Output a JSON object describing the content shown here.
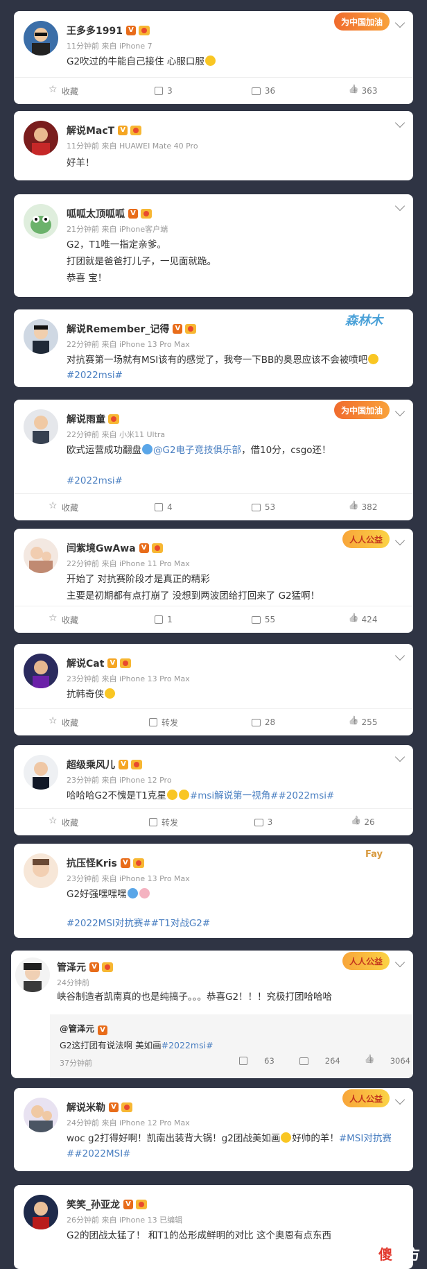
{
  "posts": [
    {
      "username": "王多多1991",
      "meta": "11分钟前 来自 iPhone 7",
      "lines": [
        "G2吹过的牛能自己接住 心服口服"
      ],
      "deco": "为中国加油",
      "actions": {
        "fav": "收藏",
        "share": "3",
        "comment": "36",
        "like": "363"
      }
    },
    {
      "username": "解说MacT",
      "meta": "11分钟前 来自 HUAWEI Mate 40 Pro",
      "lines": [
        "好羊！"
      ]
    },
    {
      "username": "呱呱太顶呱呱",
      "meta": "21分钟前 来自 iPhone客户端",
      "lines": [
        "G2，T1唯一指定亲爹。",
        "打团就是爸爸打儿子，一见面就跪。",
        "恭喜 宝！"
      ]
    },
    {
      "username": "解说Remember_记得",
      "meta": "22分钟前 来自 iPhone 13 Pro Max",
      "lines": [
        "对抗赛第一场就有MSI该有的感觉了，我夸一下BB的奥恩应该不会被喷吧"
      ],
      "tags": "#2022msi#",
      "deco": "森林木"
    },
    {
      "username": "解说雨童",
      "meta": "22分钟前 来自 小米11 Ultra",
      "line1a": "欧式运营成功翻盘",
      "mention": "@G2电子竞技俱乐部",
      "line1b": "，借10分，csgo还！",
      "tags": "#2022msi#",
      "deco": "为中国加油",
      "actions": {
        "fav": "收藏",
        "share": "4",
        "comment": "53",
        "like": "382"
      }
    },
    {
      "username": "闫紫境GwAwa",
      "meta": "22分钟前 来自 iPhone 11 Pro Max",
      "lines": [
        "开始了 对抗赛阶段才是真正的精彩",
        "主要是初期都有点打崩了 没想到两波团给打回来了 G2猛啊！"
      ],
      "deco": "人人公益",
      "actions": {
        "fav": "收藏",
        "share": "1",
        "comment": "55",
        "like": "424"
      }
    },
    {
      "username": "解说Cat",
      "meta": "23分钟前 来自 iPhone 13 Pro Max",
      "lines": [
        "抗韩奇侠"
      ],
      "actions": {
        "fav": "收藏",
        "share": "转发",
        "comment": "28",
        "like": "255"
      }
    },
    {
      "username": "超级乘风儿",
      "meta": "23分钟前 来自 iPhone 12 Pro",
      "line1a": "哈哈哈G2不愧是T1克星",
      "tags": "#msi解说第一视角##2022msi#",
      "actions": {
        "fav": "收藏",
        "share": "转发",
        "comment": "3",
        "like": "26"
      }
    },
    {
      "username": "抗压怪Kris",
      "meta": "23分钟前 来自 iPhone 13 Pro Max",
      "lines": [
        "G2好强嘿嘿嘿"
      ],
      "tags": "#2022MSI对抗赛##T1对战G2#",
      "deco": "Fay"
    },
    {
      "username": "管泽元",
      "meta": "24分钟前",
      "lines": [
        "峡谷制造者凯南真的也是纯搞子。。。恭喜G2！！！究极打团哈哈哈"
      ],
      "deco": "人人公益",
      "quote": {
        "user": "@管泽元",
        "text": "G2这打团有说法啊 美如画",
        "tag": "#2022msi#",
        "time": "37分钟前",
        "share": "63",
        "comment": "264",
        "like": "3064"
      }
    },
    {
      "username": "解说米勒",
      "meta": "24分钟前 来自 iPhone 12 Pro Max",
      "line1a": "woc g2打得好啊！凯南出装背大锅！g2团战美如画",
      "line1b": "好帅的羊！",
      "tags1": "#MSI对抗赛",
      "tags": "##2022MSI#",
      "deco": "人人公益"
    },
    {
      "username": "笑笑_孙亚龙",
      "meta": "26分钟前 来自 iPhone 13  已编辑",
      "lines": [
        "G2的团战太猛了！ 和T1的怂形成鲜明的对比 这个奥恩有点东西"
      ]
    }
  ],
  "watermark": {
    "a": "傻",
    "b": "大方"
  },
  "colors": {
    "background": "#2f3444",
    "link": "#4a7fc1",
    "vip": "#e86c1a"
  }
}
